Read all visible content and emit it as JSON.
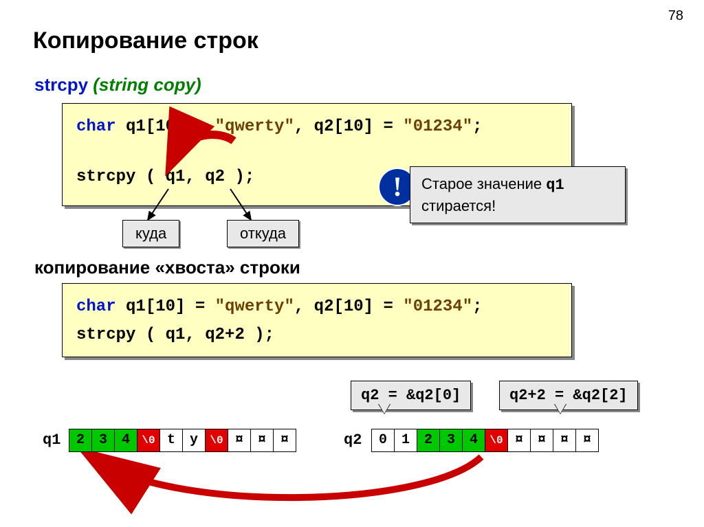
{
  "page_number": "78",
  "title": "Копирование строк",
  "subtitle_fn": "strcpy",
  "subtitle_desc": " (string copy)",
  "code1": {
    "decl_kw": "char",
    "decl_rest": " q1[10] = ",
    "decl_str1": "\"qwerty\"",
    "decl_mid": ", q2[10] = ",
    "decl_str2": "\"01234\"",
    "decl_end": ";",
    "call": "strcpy ( q1, q2 );"
  },
  "label_dest": "куда",
  "label_src": "откуда",
  "warn_line1_a": "Старое значение ",
  "warn_line1_b": "q1",
  "warn_line2": "стирается!",
  "excl": "!",
  "section2": "копирование «хвоста» строки",
  "code2": {
    "decl_kw": "char",
    "decl_rest": " q1[10] = ",
    "decl_str1": "\"qwerty\"",
    "decl_mid": ", q2[10] = ",
    "decl_str2": "\"01234\"",
    "decl_end": ";",
    "call": "strcpy ( q1, q2+2 );"
  },
  "speech1": "q2 = &q2[0]",
  "speech2": "q2+2 = &q2[2]",
  "mem_label_q1": "q1",
  "mem_label_q2": "q2",
  "q1_cells": [
    "2",
    "3",
    "4",
    "\\0",
    "t",
    "y",
    "\\0",
    "¤",
    "¤",
    "¤"
  ],
  "q2_cells": [
    "0",
    "1",
    "2",
    "3",
    "4",
    "\\0",
    "¤",
    "¤",
    "¤",
    "¤"
  ]
}
